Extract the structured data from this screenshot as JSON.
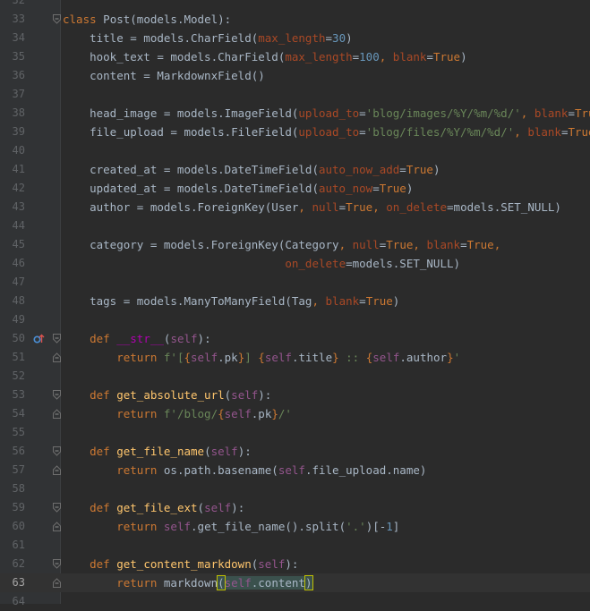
{
  "editor": {
    "line_numbers": [
      "32",
      "33",
      "34",
      "35",
      "36",
      "37",
      "38",
      "39",
      "40",
      "41",
      "42",
      "43",
      "44",
      "45",
      "46",
      "47",
      "48",
      "49",
      "50",
      "51",
      "52",
      "53",
      "54",
      "55",
      "56",
      "57",
      "58",
      "59",
      "60",
      "61",
      "62",
      "63",
      "64"
    ],
    "current_line": "63",
    "icons": {
      "override_marker": "override-method-icon",
      "fold_marker": "fold-marker-icon"
    },
    "colors": {
      "background": "#2b2b2b",
      "gutter": "#313335",
      "keyword": "#cc7832",
      "function": "#ffc66d",
      "self": "#94558d",
      "param": "#aa4926",
      "string": "#6a8759",
      "number": "#6897bb",
      "text": "#a9b7c6"
    }
  },
  "code": {
    "l33": [
      "class",
      " ",
      "Post",
      "(models.Model):"
    ],
    "l34": [
      "    title = models.CharField(",
      "max_length",
      "=",
      "30",
      ")"
    ],
    "l35": [
      "    hook_text = models.CharField(",
      "max_length",
      "=",
      "100",
      ", ",
      "blank",
      "=",
      "True",
      ")"
    ],
    "l36": [
      "    content = MarkdownxField()"
    ],
    "l38": [
      "    head_image = models.ImageField(",
      "upload_to",
      "=",
      "'blog/images/%Y/%m/%d/'",
      ", ",
      "blank",
      "=",
      "True",
      ")"
    ],
    "l39": [
      "    file_upload = models.FileField(",
      "upload_to",
      "=",
      "'blog/files/%Y/%m/%d/'",
      ", ",
      "blank",
      "=",
      "True",
      ")"
    ],
    "l41": [
      "    created_at = models.DateTimeField(",
      "auto_now_add",
      "=",
      "True",
      ")"
    ],
    "l42": [
      "    updated_at = models.DateTimeField(",
      "auto_now",
      "=",
      "True",
      ")"
    ],
    "l43": [
      "    author = models.ForeignKey(User",
      ", ",
      "null",
      "=",
      "True",
      ", ",
      "on_delete",
      "=models.SET_NULL)"
    ],
    "l45": [
      "    category = models.ForeignKey(Category",
      ", ",
      "null",
      "=",
      "True",
      ", ",
      "blank",
      "=",
      "True",
      ","
    ],
    "l46": [
      "                                 ",
      "on_delete",
      "=models.SET_NULL)"
    ],
    "l48": [
      "    tags = models.ManyToManyField(Tag",
      ", ",
      "blank",
      "=",
      "True",
      ")"
    ],
    "l50": [
      "    ",
      "def",
      " ",
      "__str__",
      "(",
      "self",
      "):"
    ],
    "l51": [
      "        ",
      "return",
      " ",
      "f'[",
      "{",
      "self",
      ".pk",
      "}",
      "] ",
      "{",
      "self",
      ".title",
      "}",
      " :: ",
      "{",
      "self",
      ".author",
      "}",
      "'"
    ],
    "l53": [
      "    ",
      "def",
      " ",
      "get_absolute_url",
      "(",
      "self",
      "):"
    ],
    "l54": [
      "        ",
      "return",
      " ",
      "f'/blog/",
      "{",
      "self",
      ".pk",
      "}",
      "/'"
    ],
    "l56": [
      "    ",
      "def",
      " ",
      "get_file_name",
      "(",
      "self",
      "):"
    ],
    "l57": [
      "        ",
      "return",
      " os.path.basename(",
      "self",
      ".file_upload.name)"
    ],
    "l59": [
      "    ",
      "def",
      " ",
      "get_file_ext",
      "(",
      "self",
      "):"
    ],
    "l60": [
      "        ",
      "return",
      " ",
      "self",
      ".get_file_name().split(",
      "'.'",
      ")[-",
      "1",
      "]"
    ],
    "l62": [
      "    ",
      "def",
      " ",
      "get_content_markdown",
      "(",
      "self",
      "):"
    ],
    "l63": [
      "        ",
      "return",
      " markdown",
      "(",
      "self",
      ".content",
      ")"
    ]
  }
}
